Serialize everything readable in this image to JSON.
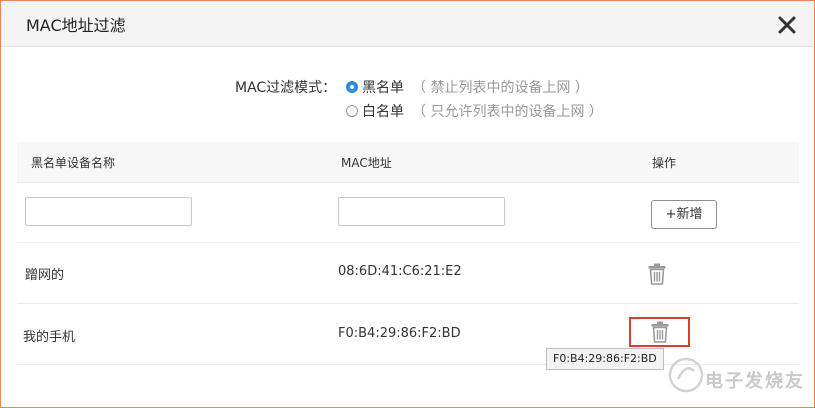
{
  "dialog": {
    "title": "MAC地址过滤",
    "close_icon": "close-icon"
  },
  "filter_mode": {
    "label": "MAC过滤模式：",
    "options": [
      {
        "label": "黑名单",
        "hint": "（ 禁止列表中的设备上网 ）",
        "selected": true
      },
      {
        "label": "白名单",
        "hint": "（ 只允许列表中的设备上网 ）",
        "selected": false
      }
    ]
  },
  "table": {
    "headers": [
      "黑名单设备名称",
      "MAC地址",
      "操作"
    ],
    "new_row": {
      "name_value": "",
      "mac_value": "",
      "add_button": "+新增"
    },
    "rows": [
      {
        "name": "蹭网的",
        "mac": "08:6D:41:C6:21:E2",
        "action_icon": "trash-icon"
      },
      {
        "name": "我的手机",
        "mac": "F0:B4:29:86:F2:BD",
        "action_icon": "trash-icon"
      }
    ]
  },
  "tooltip": "F0:B4:29:86:F2:BD",
  "watermark": "电子发烧友",
  "colors": {
    "accent": "#2c8be0",
    "highlight": "#d9412c",
    "dialog_border": "#e9855a"
  }
}
